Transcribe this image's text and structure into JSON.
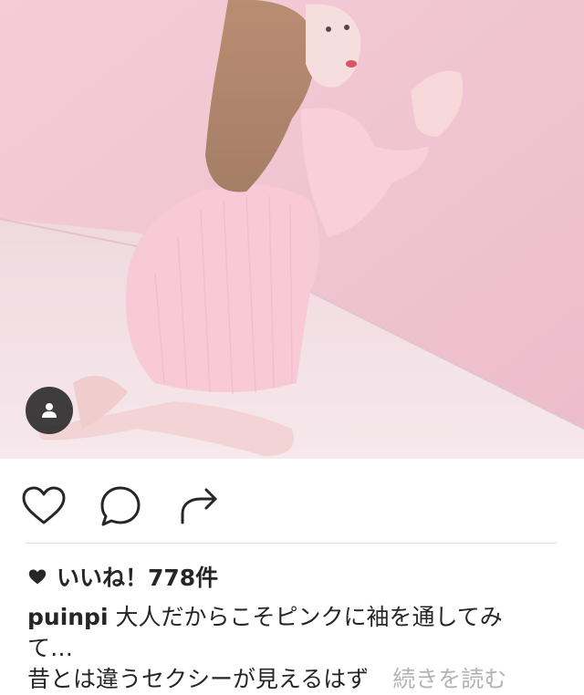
{
  "post": {
    "likes_label": "いいね！778件",
    "username": "puinpi",
    "caption_line1": "大人だからこそピンクに袖を通してみ",
    "caption_line2": "て…",
    "caption_line3": "昔とは違うセクシーが見えるはず",
    "more_label": "続きを読む"
  },
  "icons": [
    "user-tag-icon",
    "heart-icon",
    "comment-icon",
    "share-icon",
    "heart-filled-icon"
  ],
  "colors": {
    "text": "#262626",
    "muted": "#b4b4b4",
    "divider": "#dbdbdb",
    "photo_bg": "#f1c6d2"
  }
}
